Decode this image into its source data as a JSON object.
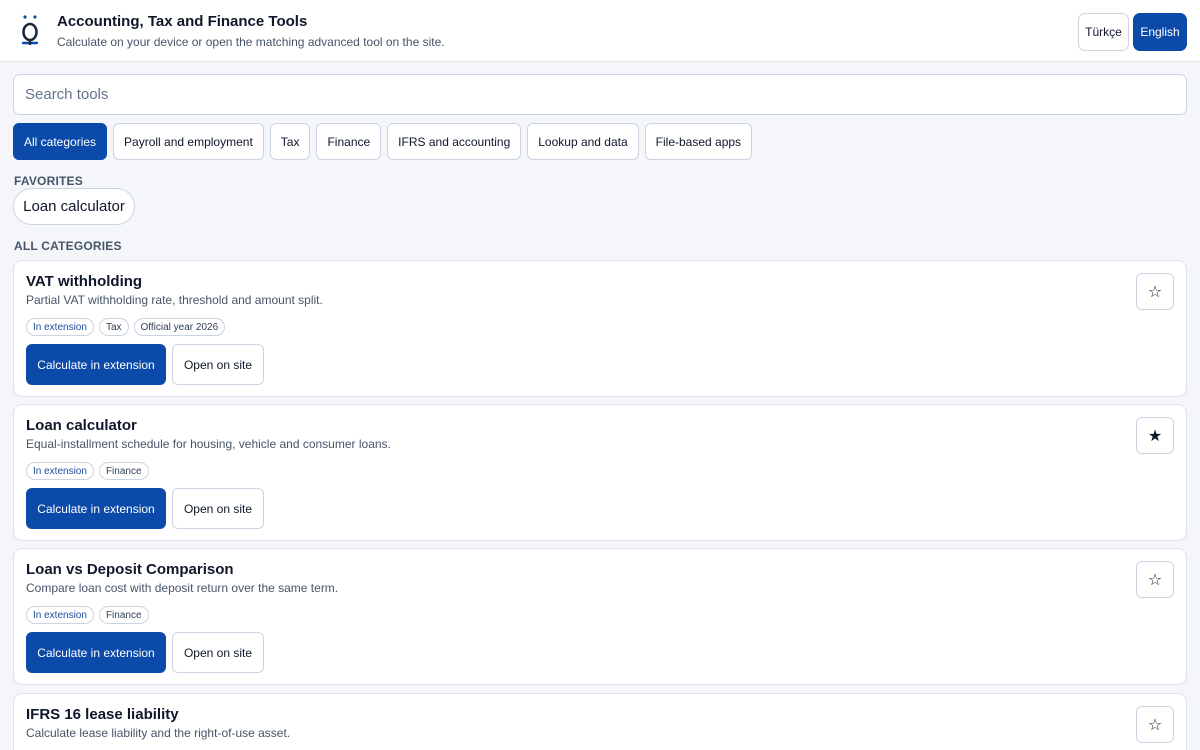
{
  "header": {
    "title": "Accounting, Tax and Finance Tools",
    "subtitle": "Calculate on your device or open the matching advanced tool on the site.",
    "languages": [
      "Türkçe",
      "English"
    ],
    "active_language": "English",
    "accent_color": "#0b4aa8"
  },
  "search": {
    "placeholder": "Search tools",
    "value": ""
  },
  "categories": [
    "All categories",
    "Payroll and employment",
    "Tax",
    "Finance",
    "IFRS and accounting",
    "Lookup and data",
    "File-based apps"
  ],
  "active_category": "All categories",
  "favorites": {
    "label": "FAVORITES",
    "items": [
      "Loan calculator"
    ]
  },
  "all_categories_label": "ALL CATEGORIES",
  "cards": [
    {
      "title": "VAT withholding",
      "desc": "Partial VAT withholding rate, threshold and amount split.",
      "tags": [
        "In extension",
        "Tax",
        "Official year 2026"
      ],
      "primary": "Calculate in extension",
      "secondary": "Open on site",
      "favorite_icon": "star-outline-icon",
      "star": "☆"
    },
    {
      "title": "Loan calculator",
      "desc": "Equal-installment schedule for housing, vehicle and consumer loans.",
      "tags": [
        "In extension",
        "Finance"
      ],
      "primary": "Calculate in extension",
      "secondary": "Open on site",
      "favorite_icon": "star-filled-icon",
      "star": "★"
    },
    {
      "title": "Loan vs Deposit Comparison",
      "desc": "Compare loan cost with deposit return over the same term.",
      "tags": [
        "In extension",
        "Finance"
      ],
      "primary": "Calculate in extension",
      "secondary": "Open on site",
      "favorite_icon": "star-outline-icon",
      "star": "☆"
    },
    {
      "title": "IFRS 16 lease liability",
      "desc": "Calculate lease liability and the right-of-use asset.",
      "tags": [],
      "primary": "",
      "secondary": "",
      "favorite_icon": "star-outline-icon",
      "star": "☆"
    }
  ]
}
